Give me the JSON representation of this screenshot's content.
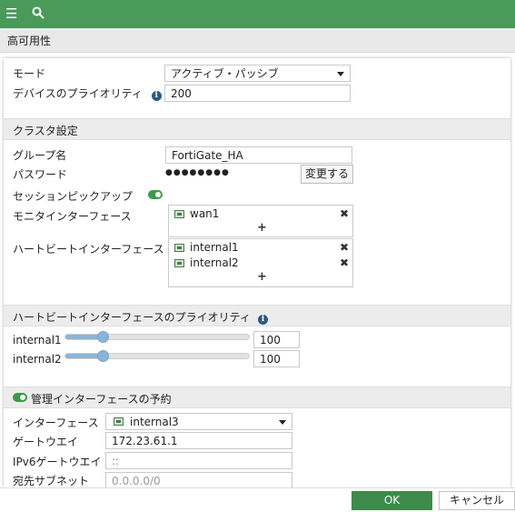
{
  "topbar": {
    "menu_icon": "hamburger-icon",
    "search_icon": "search-icon"
  },
  "page_title": "高可用性",
  "form": {
    "mode_label": "モード",
    "mode_value": "アクティブ・パッシブ",
    "priority_label": "デバイスのプライオリティ",
    "priority_value": "200",
    "cluster_section": "クラスタ設定",
    "group_label": "グループ名",
    "group_value": "FortiGate_HA",
    "password_label": "パスワード",
    "password_value": "●●●●●●●●",
    "change_button": "変更する",
    "session_pickup_label": "セッションピックアップ",
    "session_pickup_on": true,
    "monitor_label": "モニタインターフェース",
    "monitor_items": [
      "wan1"
    ],
    "heartbeat_label": "ハートビートインターフェース",
    "heartbeat_items": [
      "internal1",
      "internal2"
    ],
    "plus": "+",
    "remove": "✖"
  },
  "hb_priority": {
    "section": "ハートビートインターフェースのプライオリティ",
    "rows": [
      {
        "name": "internal1",
        "value": "100",
        "level": 0.2
      },
      {
        "name": "internal2",
        "value": "100",
        "level": 0.2
      }
    ]
  },
  "mgmt": {
    "section": "管理インターフェースの予約",
    "enabled": true,
    "interface_label": "インターフェース",
    "interface_value": "internal3",
    "gateway_label": "ゲートウエイ",
    "gateway_value": "172.23.61.1",
    "ipv6_label": "IPv6ゲートウエイ",
    "ipv6_value": "::",
    "dest_label": "宛先サブネット",
    "dest_value": "0.0.0.0/0"
  },
  "footer": {
    "ok": "OK",
    "cancel": "キャンセル"
  },
  "colors": {
    "accent": "#4a9a5a",
    "ok": "#3d8a4b",
    "slider": "#8ab4d6"
  }
}
